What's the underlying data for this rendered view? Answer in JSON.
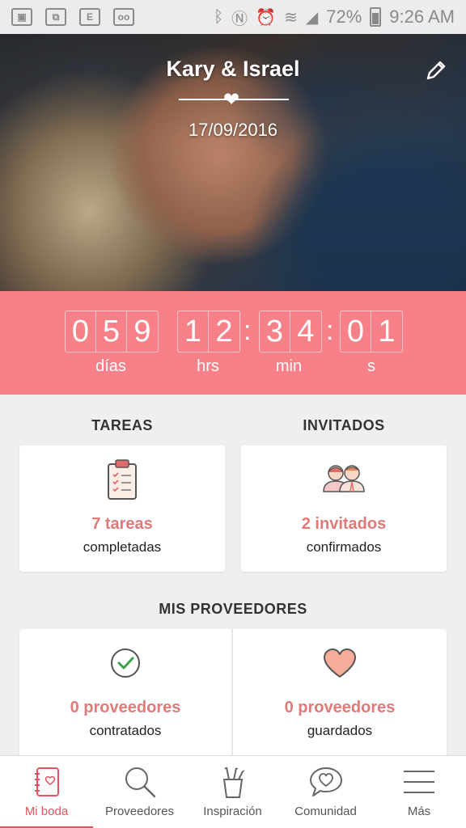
{
  "status_bar": {
    "left_icons": [
      "gallery-icon",
      "cast-icon",
      "e-icon",
      "voicemail-icon"
    ],
    "right_icons": [
      "bluetooth-icon",
      "nfc-icon",
      "alarm-icon",
      "wifi-icon",
      "signal-icon"
    ],
    "battery": "72%",
    "time": "9:26 AM"
  },
  "header": {
    "names": "Kary & Israel",
    "date": "17/09/2016"
  },
  "countdown": {
    "days_digits": [
      "0",
      "5",
      "9"
    ],
    "hours_digits": [
      "1",
      "2"
    ],
    "minutes_digits": [
      "3",
      "4"
    ],
    "seconds_digits": [
      "0",
      "1"
    ],
    "days_label": "días",
    "hours_label": "hrs",
    "minutes_label": "min",
    "seconds_label": "s",
    "separator": ":"
  },
  "tareas": {
    "title": "TAREAS",
    "value": "7 tareas",
    "caption": "completadas"
  },
  "invitados": {
    "title": "INVITADOS",
    "value": "2 invitados",
    "caption": "confirmados"
  },
  "proveedores": {
    "title": "MIS PROVEEDORES",
    "contratados_value": "0 proveedores",
    "contratados_caption": "contratados",
    "guardados_value": "0 proveedores",
    "guardados_caption": "guardados"
  },
  "nav": {
    "items": [
      {
        "label": "Mi boda",
        "icon": "notebook-icon"
      },
      {
        "label": "Proveedores",
        "icon": "search-icon"
      },
      {
        "label": "Inspiración",
        "icon": "pencil-cup-icon"
      },
      {
        "label": "Comunidad",
        "icon": "chat-heart-icon"
      },
      {
        "label": "Más",
        "icon": "menu-icon"
      }
    ]
  },
  "colors": {
    "accent": "#f78089",
    "active_nav": "#e0545d",
    "value_text": "#e07a79"
  }
}
